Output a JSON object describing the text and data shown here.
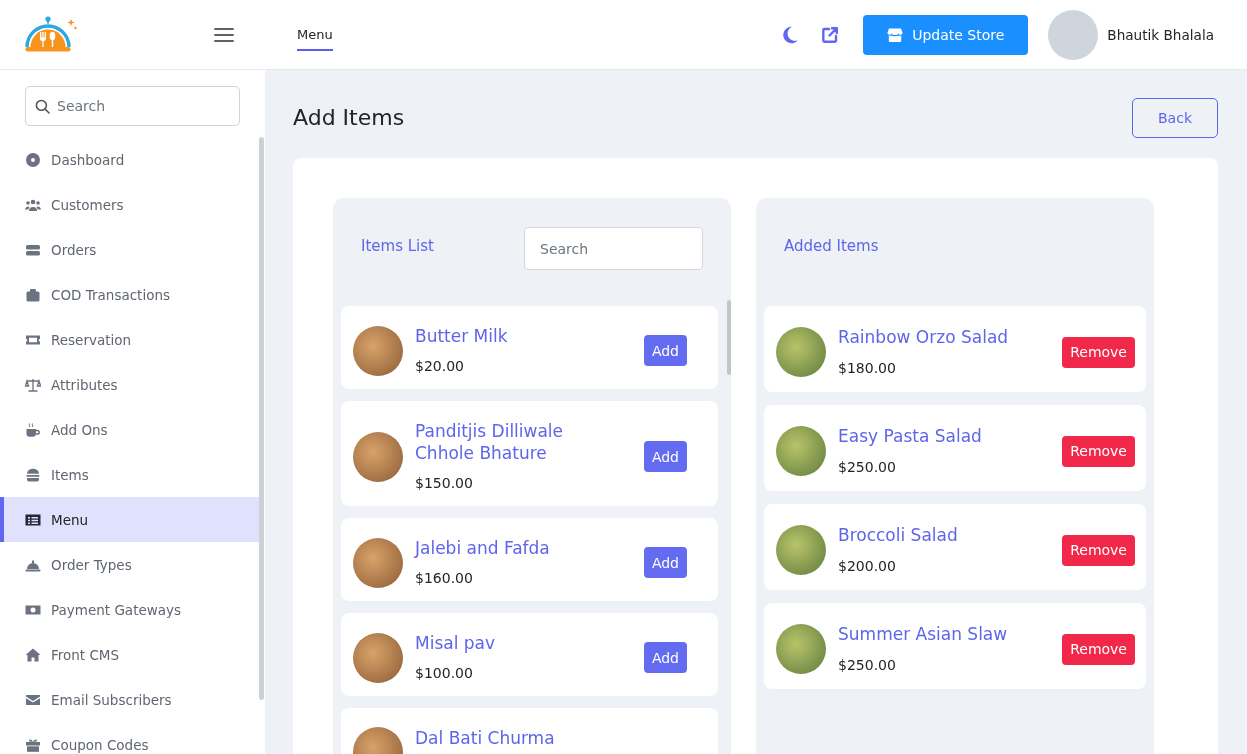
{
  "header": {
    "tabs": [
      {
        "label": "Menu",
        "selected": true
      }
    ],
    "update_button": "Update Store",
    "user_name": "Bhautik Bhalala"
  },
  "sidebar": {
    "search": {
      "placeholder": "Search"
    },
    "items": [
      {
        "label": "Dashboard",
        "selected": false
      },
      {
        "label": "Customers",
        "selected": false
      },
      {
        "label": "Orders",
        "selected": false
      },
      {
        "label": "COD Transactions",
        "selected": false
      },
      {
        "label": "Reservation",
        "selected": false
      },
      {
        "label": "Attributes",
        "selected": false
      },
      {
        "label": "Add Ons",
        "selected": false
      },
      {
        "label": "Items",
        "selected": false
      },
      {
        "label": "Menu",
        "selected": true
      },
      {
        "label": "Order Types",
        "selected": false
      },
      {
        "label": "Payment Gateways",
        "selected": false
      },
      {
        "label": "Front CMS",
        "selected": false
      },
      {
        "label": "Email Subscribers",
        "selected": false
      },
      {
        "label": "Coupon Codes",
        "selected": false
      }
    ]
  },
  "page": {
    "title": "Add Items",
    "back_button": "Back"
  },
  "items_list": {
    "title": "Items List",
    "search": {
      "placeholder": "Search"
    },
    "items": [
      {
        "name": "Butter Milk",
        "price": "$20.00",
        "button": "Add"
      },
      {
        "name": "Panditjis Dilliwale Chhole Bhature",
        "price": "$150.00",
        "button": "Add"
      },
      {
        "name": "Jalebi and Fafda",
        "price": "$160.00",
        "button": "Add"
      },
      {
        "name": "Misal pav",
        "price": "$100.00",
        "button": "Add"
      },
      {
        "name": "Dal Bati Churma"
      }
    ]
  },
  "added_items": {
    "title": "Added Items",
    "items": [
      {
        "name": "Rainbow Orzo Salad",
        "price": "$180.00",
        "button": "Remove"
      },
      {
        "name": "Easy Pasta Salad",
        "price": "$250.00",
        "button": "Remove"
      },
      {
        "name": "Broccoli Salad",
        "price": "$200.00",
        "button": "Remove"
      },
      {
        "name": "Summer Asian Slaw",
        "price": "$250.00",
        "button": "Remove"
      }
    ]
  }
}
